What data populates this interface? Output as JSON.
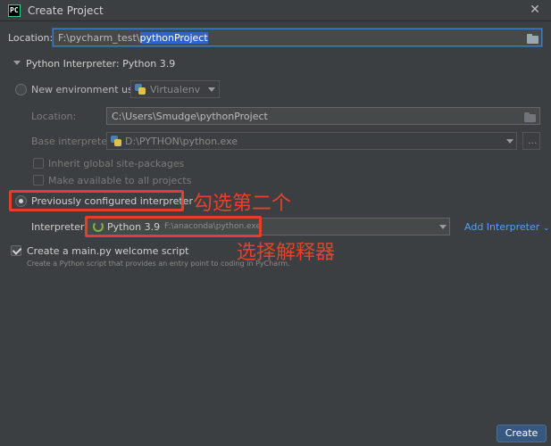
{
  "window": {
    "title": "Create Project",
    "app_icon_text": "PC"
  },
  "location": {
    "label": "Location:",
    "prefix": "F:\\pycharm_test\\",
    "selected": "pythonProject"
  },
  "interpreter_section": {
    "header": "Python Interpreter: Python 3.9"
  },
  "new_env": {
    "radio_label": "New environment using",
    "tool": "Virtualenv",
    "location_label": "Location:",
    "location_value": "C:\\Users\\Smudge\\pythonProject",
    "base_label": "Base interpreter:",
    "base_value": "D:\\PYTHON\\python.exe",
    "browse_label": "...",
    "inherit_label": "Inherit global site-packages",
    "available_label": "Make available to all projects"
  },
  "prev_env": {
    "radio_label": "Previously configured interpreter",
    "interpreter_label": "Interpreter:",
    "interpreter_name": "Python 3.9",
    "interpreter_path": "F:\\anaconda\\python.exe",
    "add_label": "Add Interpreter"
  },
  "welcome": {
    "label": "Create a main.py welcome script",
    "description": "Create a Python script that provides an entry point to coding in PyCharm."
  },
  "annotations": {
    "first": "勾选第二个",
    "second": "选择解释器"
  },
  "actions": {
    "create_label": "Create"
  },
  "colors": {
    "background": "#3c3f41",
    "accent": "#365880",
    "annotation": "#e53f2b",
    "selection": "#2f65ca"
  }
}
